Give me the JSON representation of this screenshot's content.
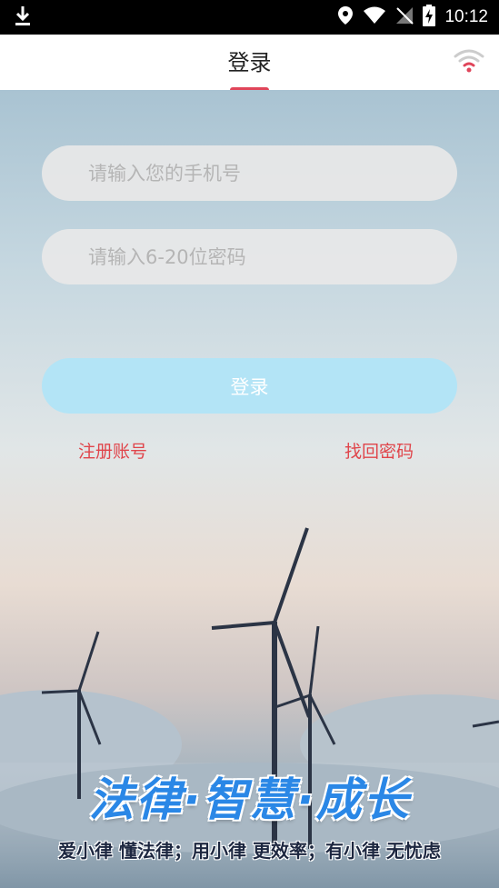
{
  "status_bar": {
    "time": "10:12",
    "icons": [
      "download-icon",
      "location-icon",
      "wifi-signal-icon",
      "no-sim-icon",
      "battery-charging-icon"
    ]
  },
  "header": {
    "title": "登录",
    "accent_color": "#e0455a",
    "wifi_icon": "wifi-icon"
  },
  "form": {
    "phone_placeholder": "请输入您的手机号",
    "phone_value": "",
    "password_placeholder": "请输入6-20位密码",
    "password_value": "",
    "login_label": "登录",
    "login_color": "#b3e4f6"
  },
  "links": {
    "register": "注册账号",
    "forgot_password": "找回密码",
    "link_color": "#e0454b"
  },
  "slogan": {
    "main": "法律·智慧·成长",
    "sub": "爱小律 懂法律；用小律 更效率；有小律 无忧虑"
  }
}
